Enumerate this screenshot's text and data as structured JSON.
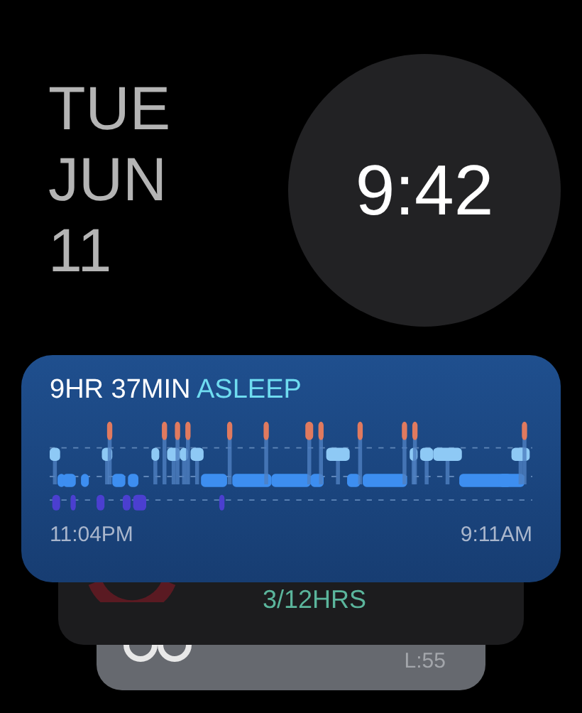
{
  "date": {
    "weekday": "TUE",
    "month": "JUN",
    "day": "11"
  },
  "clock": {
    "time": "9:42"
  },
  "stack": [
    {
      "kind": "sleep",
      "headline": "9HR 37MIN",
      "status": "ASLEEP",
      "start": "11:04PM",
      "end": "9:11AM"
    },
    {
      "kind": "activity",
      "value": "3/12HRS"
    },
    {
      "kind": "weather",
      "value": "L:55"
    }
  ]
}
